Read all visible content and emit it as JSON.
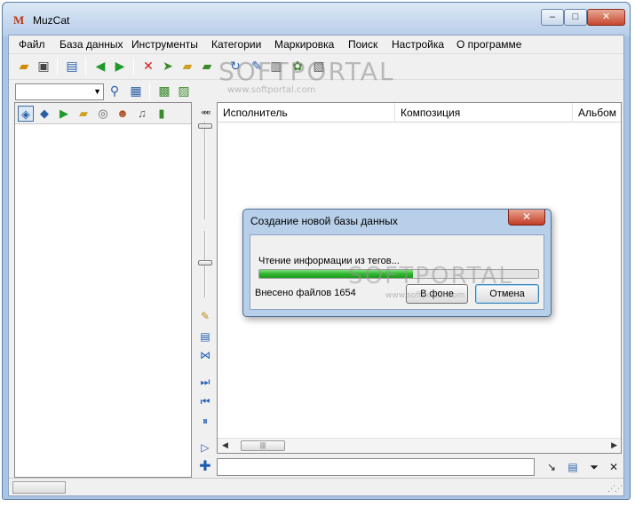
{
  "window": {
    "title": "MuzCat",
    "logo_text": "M"
  },
  "caption_buttons": {
    "minimize": "–",
    "maximize": "□",
    "close": "✕"
  },
  "menu": [
    "Файл",
    "База данных",
    "Инструменты",
    "Категории",
    "Маркировка",
    "Поиск",
    "Настройка",
    "О программе"
  ],
  "watermarks": {
    "big": "SOFTPORTAL",
    "small": "www.softportal.com"
  },
  "columns": [
    "Исполнитель",
    "Композиция",
    "Альбом"
  ],
  "strip": {
    "collapse": "«««"
  },
  "dialog": {
    "title": "Создание новой базы данных",
    "status": "Чтение информации из тегов...",
    "count": "Внесено файлов 1654",
    "progress": 0.55,
    "buttons": {
      "background": "В фоне",
      "cancel": "Отмена"
    }
  },
  "colors": {
    "accent": "#3a6ea5",
    "progress": "#2fb52f",
    "close": "#c8452e"
  }
}
